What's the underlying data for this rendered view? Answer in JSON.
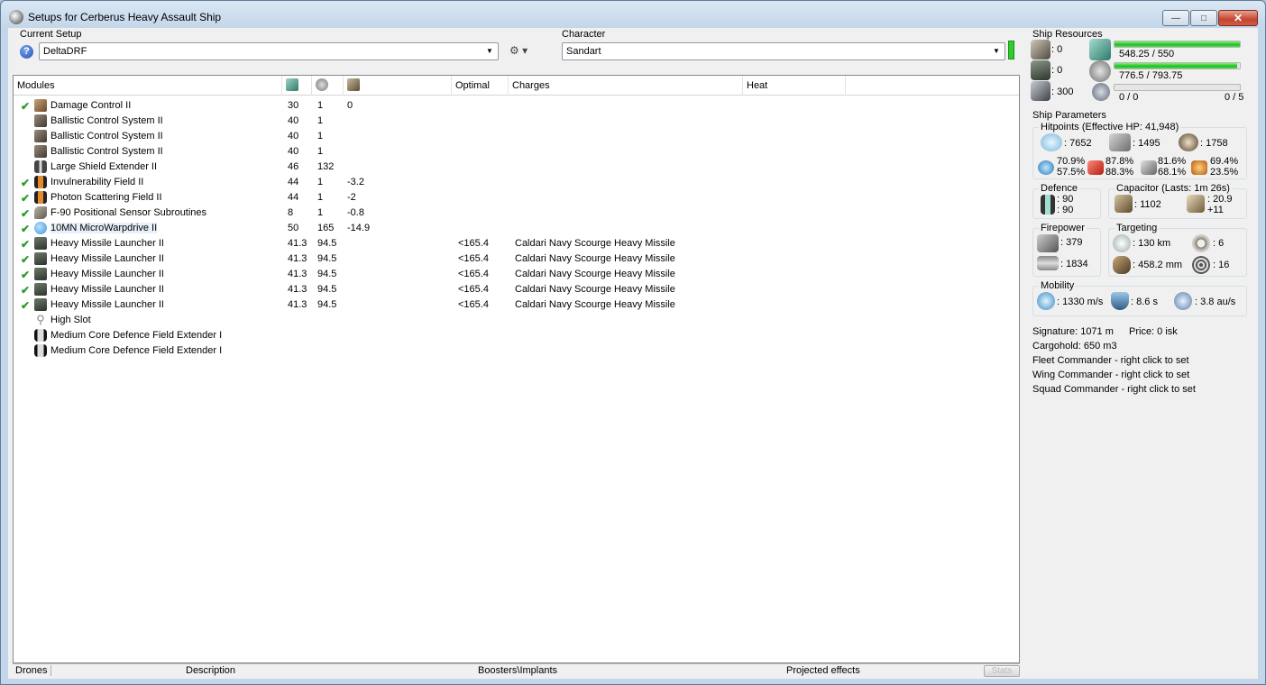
{
  "window": {
    "title": "Setups for Cerberus Heavy Assault Ship",
    "controls": {
      "minimize": "—",
      "maximize": "□",
      "close": "✕"
    }
  },
  "setup": {
    "current_label": "Current Setup",
    "current_value": "DeltaDRF",
    "character_label": "Character",
    "character_value": "Sandart",
    "help_glyph": "?",
    "tool_glyph": "⚙ ▾"
  },
  "modules": {
    "headers": {
      "modules": "Modules",
      "optimal": "Optimal",
      "charges": "Charges",
      "heat": "Heat"
    },
    "rows": [
      {
        "active": true,
        "icon": "damage-control-icon",
        "name": "Damage Control II",
        "cpu": "30",
        "pg": "1",
        "cap": "0",
        "optimal": "",
        "charges": ""
      },
      {
        "active": false,
        "icon": "ballistic-control-icon",
        "name": "Ballistic Control System II",
        "cpu": "40",
        "pg": "1",
        "cap": "",
        "optimal": "",
        "charges": ""
      },
      {
        "active": false,
        "icon": "ballistic-control-icon",
        "name": "Ballistic Control System II",
        "cpu": "40",
        "pg": "1",
        "cap": "",
        "optimal": "",
        "charges": ""
      },
      {
        "active": false,
        "icon": "ballistic-control-icon",
        "name": "Ballistic Control System II",
        "cpu": "40",
        "pg": "1",
        "cap": "",
        "optimal": "",
        "charges": ""
      },
      {
        "active": false,
        "icon": "shield-extender-icon",
        "name": "Large Shield Extender II",
        "cpu": "46",
        "pg": "132",
        "cap": "",
        "optimal": "",
        "charges": ""
      },
      {
        "active": true,
        "icon": "invulnerability-field-icon",
        "name": "Invulnerability Field II",
        "cpu": "44",
        "pg": "1",
        "cap": "-3.2",
        "optimal": "",
        "charges": ""
      },
      {
        "active": true,
        "icon": "invulnerability-field-icon",
        "name": "Photon Scattering Field II",
        "cpu": "44",
        "pg": "1",
        "cap": "-2",
        "optimal": "",
        "charges": ""
      },
      {
        "active": true,
        "icon": "sensor-subroutines-icon",
        "name": "F-90 Positional Sensor Subroutines",
        "cpu": "8",
        "pg": "1",
        "cap": "-0.8",
        "optimal": "",
        "charges": ""
      },
      {
        "active": true,
        "icon": "microwarpdrive-icon",
        "name": "10MN MicroWarpdrive II",
        "cpu": "50",
        "pg": "165",
        "cap": "-14.9",
        "optimal": "",
        "charges": ""
      },
      {
        "active": true,
        "icon": "missile-launcher-icon",
        "name": "Heavy Missile Launcher II",
        "cpu": "41.3",
        "pg": "94.5",
        "cap": "",
        "optimal": "<165.4",
        "charges": "Caldari Navy Scourge Heavy Missile"
      },
      {
        "active": true,
        "icon": "missile-launcher-icon",
        "name": "Heavy Missile Launcher II",
        "cpu": "41.3",
        "pg": "94.5",
        "cap": "",
        "optimal": "<165.4",
        "charges": "Caldari Navy Scourge Heavy Missile"
      },
      {
        "active": true,
        "icon": "missile-launcher-icon",
        "name": "Heavy Missile Launcher II",
        "cpu": "41.3",
        "pg": "94.5",
        "cap": "",
        "optimal": "<165.4",
        "charges": "Caldari Navy Scourge Heavy Missile"
      },
      {
        "active": true,
        "icon": "missile-launcher-icon",
        "name": "Heavy Missile Launcher II",
        "cpu": "41.3",
        "pg": "94.5",
        "cap": "",
        "optimal": "<165.4",
        "charges": "Caldari Navy Scourge Heavy Missile"
      },
      {
        "active": true,
        "icon": "missile-launcher-icon",
        "name": "Heavy Missile Launcher II",
        "cpu": "41.3",
        "pg": "94.5",
        "cap": "",
        "optimal": "<165.4",
        "charges": "Caldari Navy Scourge Heavy Missile"
      },
      {
        "active": false,
        "icon": "high-slot-icon",
        "name": "High Slot",
        "cpu": "",
        "pg": "",
        "cap": "",
        "optimal": "",
        "charges": ""
      },
      {
        "active": false,
        "icon": "core-defence-rig-icon",
        "name": "Medium Core Defence Field Extender I",
        "cpu": "",
        "pg": "",
        "cap": "",
        "optimal": "",
        "charges": ""
      },
      {
        "active": false,
        "icon": "core-defence-rig-icon",
        "name": "Medium Core Defence Field Extender I",
        "cpu": "",
        "pg": "",
        "cap": "",
        "optimal": "",
        "charges": ""
      }
    ]
  },
  "bottom_tabs": {
    "drones": "Drones",
    "description": "Description",
    "boosters": "Boosters\\Implants",
    "projected": "Projected effects",
    "stats": "Stats"
  },
  "resources": {
    "title": "Ship Resources",
    "turret_hardpoints": ": 0",
    "launcher_hardpoints": ": 0",
    "drone_bay": ": 300",
    "cpu_text": "548.25 / 550",
    "cpu_fraction": 0.9968,
    "powergrid_text": "776.5 / 793.75",
    "powergrid_fraction": 0.9783,
    "calibration_text": "0 / 0",
    "calibration_fraction": 0,
    "drone_slots_text": "0 / 5"
  },
  "parameters": {
    "title": "Ship Parameters",
    "hitpoints_title": "Hitpoints (Effective HP: 41,948)",
    "shield_hp": ": 7652",
    "armor_hp": ": 1495",
    "structure_hp": ": 1758",
    "res_em_shield": "70.9%",
    "res_em_armor": "57.5%",
    "res_thermal_shield": "87.8%",
    "res_thermal_armor": "88.3%",
    "res_kinetic_shield": "81.6%",
    "res_kinetic_armor": "68.1%",
    "res_explosive_shield": "69.4%",
    "res_explosive_armor": "23.5%",
    "defence_title": "Defence",
    "defence_1": ": 90",
    "defence_2": ": 90",
    "capacitor_title": "Capacitor (Lasts: 1m 26s)",
    "capacitor_amount": ": 1102",
    "capacitor_1": ": 20.9",
    "capacitor_2": "+11",
    "firepower_title": "Firepower",
    "firepower_1": ": 379",
    "firepower_2": ": 1834",
    "targeting_title": "Targeting",
    "target_range": ": 130 km",
    "max_targets": ": 6",
    "scan_res": ": 458.2 mm",
    "sensor_strength": ": 16",
    "mobility_title": "Mobility",
    "velocity": ": 1330 m/s",
    "align_time": ": 8.6 s",
    "warp_speed": ": 3.8 au/s"
  },
  "info": {
    "signature": "Signature: 1071 m",
    "price": "Price: 0 isk",
    "cargohold": "Cargohold: 650 m3",
    "fleet": "Fleet Commander - right click to set",
    "wing": "Wing Commander - right click to set",
    "squad": "Squad Commander - right click to set"
  },
  "colors": {
    "check": "#2d9a2d",
    "bar_fill": "#1fbd1f",
    "close_button": "#c4452e"
  }
}
